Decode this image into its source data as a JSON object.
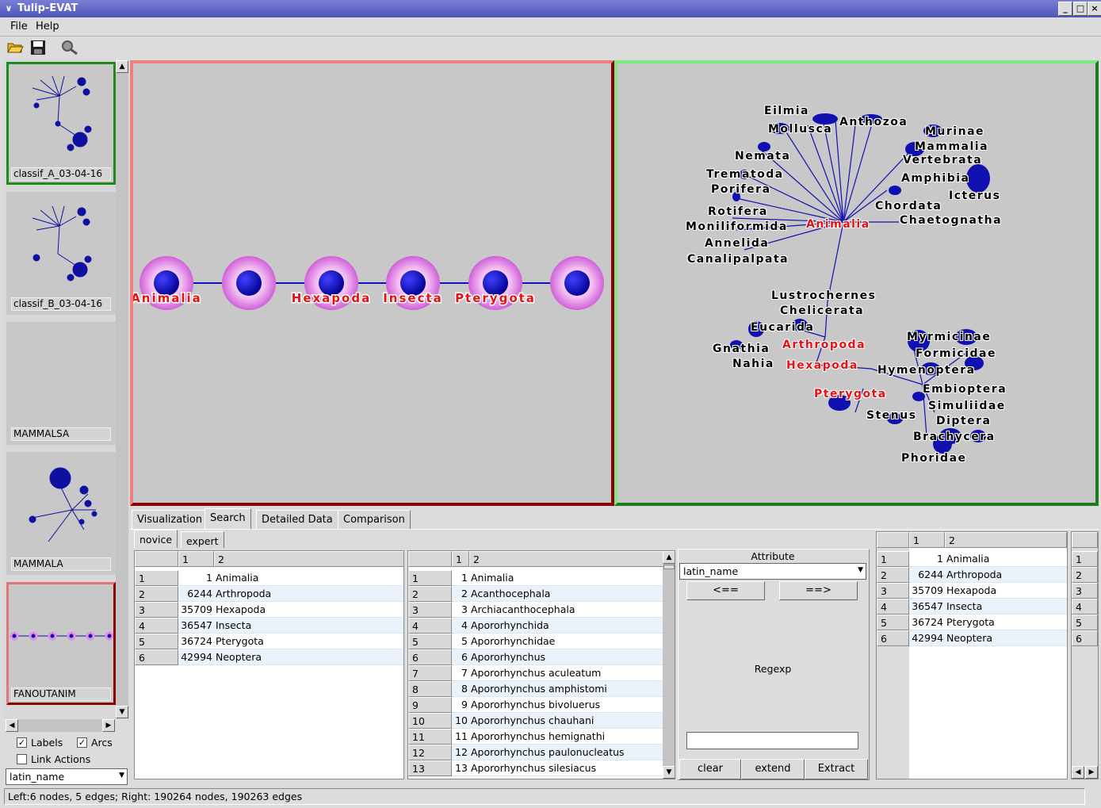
{
  "window": {
    "title": "Tulip-EVAT"
  },
  "menu": {
    "file": "File",
    "help": "Help"
  },
  "toolbar": {
    "open_icon": "folder-open-icon",
    "save_icon": "floppy-disk-icon",
    "search_icon": "magnifier-icon"
  },
  "thumbnails": [
    {
      "label": "classif_A_03-04-16",
      "border": "#1c8c1c"
    },
    {
      "label": "classif_B_03-04-16",
      "border": "#c8c8c8"
    },
    {
      "label": "MAMMALSA",
      "border": "#c8c8c8"
    },
    {
      "label": "MAMMALA",
      "border": "#c8c8c8"
    },
    {
      "label": "FANOUTANIM",
      "border": "#e07878"
    }
  ],
  "left_options": {
    "labels": "Labels",
    "arcs": "Arcs",
    "link_actions": "Link Actions",
    "attribute": "latin_name"
  },
  "left_view": {
    "nodes": [
      "Animalia",
      "",
      "Hexapoda",
      "Insecta",
      "Pterygota",
      ""
    ],
    "border_color": "#f08080"
  },
  "right_view": {
    "border_color": "#80e880",
    "labels_black": [
      "Eilmia",
      "Mollusca",
      "Anthozoa",
      "Murinae",
      "Mammalia",
      "Vertebrata",
      "Nemata",
      "Trematoda",
      "Porifera",
      "Amphibia",
      "Icterus",
      "Chordata",
      "Rotifera",
      "Chaetognatha",
      "Moniliformida",
      "Annelida",
      "Canalipalpata",
      "Lustrochernes",
      "Chelicerata",
      "Eucarida",
      "Myrmicinae",
      "Gnathia",
      "Formicidae",
      "Nahia",
      "Hymenoptera",
      "Embioptera",
      "Simuliidae",
      "Stenus",
      "Diptera",
      "Brachycera",
      "Phoridae"
    ],
    "labels_red": [
      "Animalia",
      "Arthropoda",
      "Hexapoda",
      "Pterygota"
    ]
  },
  "tabs": [
    "Visualization",
    "Search",
    "Detailed Data",
    "Comparison"
  ],
  "subtabs": [
    "novice",
    "expert"
  ],
  "table1": {
    "headers": [
      "1",
      "2"
    ],
    "rows": [
      [
        "1",
        "1",
        "Animalia"
      ],
      [
        "2",
        "6244",
        "Arthropoda"
      ],
      [
        "3",
        "35709",
        "Hexapoda"
      ],
      [
        "4",
        "36547",
        "Insecta"
      ],
      [
        "5",
        "36724",
        "Pterygota"
      ],
      [
        "6",
        "42994",
        "Neoptera"
      ]
    ]
  },
  "table2": {
    "headers": [
      "1",
      "2"
    ],
    "rows": [
      [
        "1",
        "1",
        "Animalia"
      ],
      [
        "2",
        "2",
        "Acanthocephala"
      ],
      [
        "3",
        "3",
        "Archiacanthocephala"
      ],
      [
        "4",
        "4",
        "Apororhynchida"
      ],
      [
        "5",
        "5",
        "Apororhynchidae"
      ],
      [
        "6",
        "6",
        "Apororhynchus"
      ],
      [
        "7",
        "7",
        "Apororhynchus aculeatum"
      ],
      [
        "8",
        "8",
        "Apororhynchus amphistomi"
      ],
      [
        "9",
        "9",
        "Apororhynchus bivoluerus"
      ],
      [
        "10",
        "10",
        "Apororhynchus chauhani"
      ],
      [
        "11",
        "11",
        "Apororhynchus hemignathi"
      ],
      [
        "12",
        "12",
        "Apororhynchus paulonucleatus"
      ],
      [
        "13",
        "13",
        "Apororhynchus silesiacus"
      ]
    ]
  },
  "search_panel": {
    "attribute_label": "Attribute",
    "attribute_value": "latin_name",
    "left_btn": "<==",
    "right_btn": "==>",
    "regexp_label": "Regexp",
    "regexp_value": "",
    "clear": "clear",
    "extend": "extend",
    "extract": "Extract"
  },
  "table3": {
    "headers": [
      "1",
      "2"
    ],
    "rows": [
      [
        "1",
        "1",
        "Animalia"
      ],
      [
        "2",
        "6244",
        "Arthropoda"
      ],
      [
        "3",
        "35709",
        "Hexapoda"
      ],
      [
        "4",
        "36547",
        "Insecta"
      ],
      [
        "5",
        "36724",
        "Pterygota"
      ],
      [
        "6",
        "42994",
        "Neoptera"
      ]
    ]
  },
  "table4": {
    "rows": [
      "1",
      "2",
      "3",
      "4",
      "5",
      "6"
    ]
  },
  "status": "Left:6 nodes, 5 edges; Right: 190264 nodes, 190263 edges"
}
